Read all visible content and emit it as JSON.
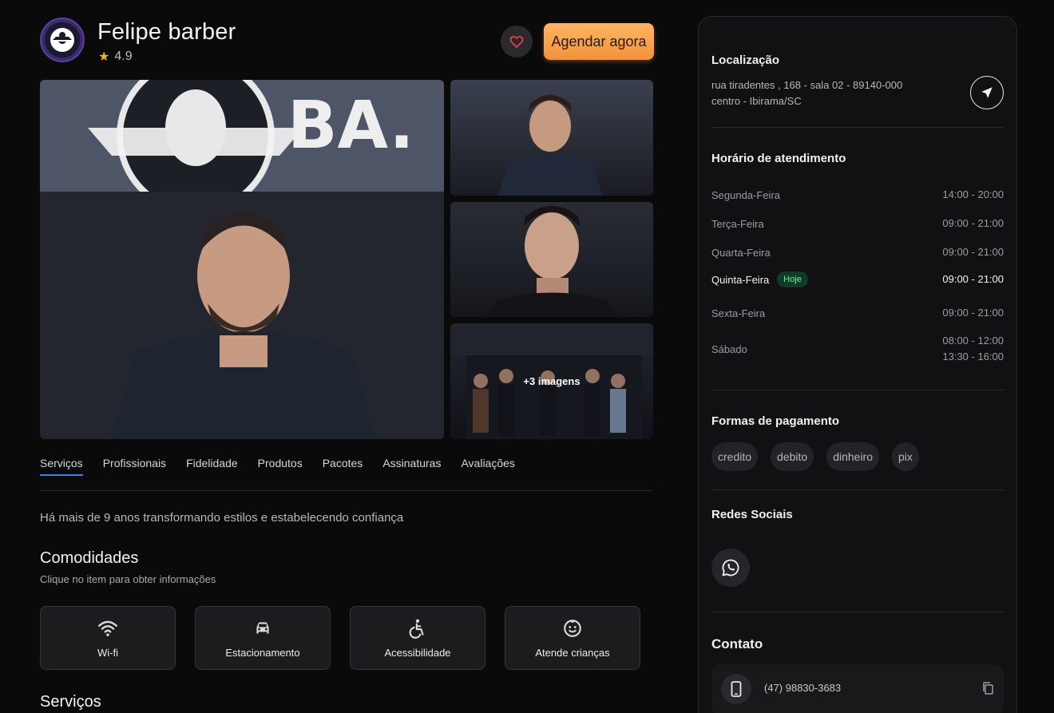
{
  "shop": {
    "name": "Felipe barber",
    "rating": "4.9",
    "book_label": "Agendar agora"
  },
  "gallery": {
    "more_label": "+3 imagens"
  },
  "tabs": [
    {
      "label": "Serviços"
    },
    {
      "label": "Profissionais"
    },
    {
      "label": "Fidelidade"
    },
    {
      "label": "Produtos"
    },
    {
      "label": "Pacotes"
    },
    {
      "label": "Assinaturas"
    },
    {
      "label": "Avaliações"
    }
  ],
  "about": {
    "description": "Há mais de 9 anos transformando estilos e estabelecendo confiança"
  },
  "amenities": {
    "title": "Comodidades",
    "subtitle": "Clique no item para obter informações",
    "items": [
      {
        "label": "Wi-fi",
        "icon": "wifi-icon"
      },
      {
        "label": "Estacionamento",
        "icon": "car-icon"
      },
      {
        "label": "Acessibilidade",
        "icon": "accessibility-icon"
      },
      {
        "label": "Atende crianças",
        "icon": "child-smile-icon"
      }
    ]
  },
  "services": {
    "title": "Serviços"
  },
  "sidebar": {
    "location": {
      "title": "Localização",
      "line1": "rua tiradentes , 168 - sala 02 - 89140-000",
      "line2": "centro - Ibirama/SC"
    },
    "hours": {
      "title": "Horário de atendimento",
      "today_label": "Hoje",
      "days": [
        {
          "day": "Segunda-Feira",
          "time": "14:00 - 20:00",
          "time2": ""
        },
        {
          "day": "Terça-Feira",
          "time": "09:00 - 21:00",
          "time2": ""
        },
        {
          "day": "Quarta-Feira",
          "time": "09:00 - 21:00",
          "time2": ""
        },
        {
          "day": "Quinta-Feira",
          "time": "09:00 - 21:00",
          "time2": ""
        },
        {
          "day": "Sexta-Feira",
          "time": "09:00 - 21:00",
          "time2": ""
        },
        {
          "day": "Sábado",
          "time": "08:00 - 12:00",
          "time2": "13:30 - 16:00"
        }
      ]
    },
    "payments": {
      "title": "Formas de pagamento",
      "methods": [
        "credito",
        "debito",
        "dinheiro",
        "pix"
      ]
    },
    "social": {
      "title": "Redes Sociais"
    },
    "contact": {
      "title": "Contato",
      "phone": "(47) 98830-3683"
    }
  },
  "colors": {
    "accent": "#f0923a",
    "tab_underline": "#3b82f6",
    "today_badge": "#7ee2a8",
    "star": "#f6b21a",
    "heart": "#ef4444"
  }
}
